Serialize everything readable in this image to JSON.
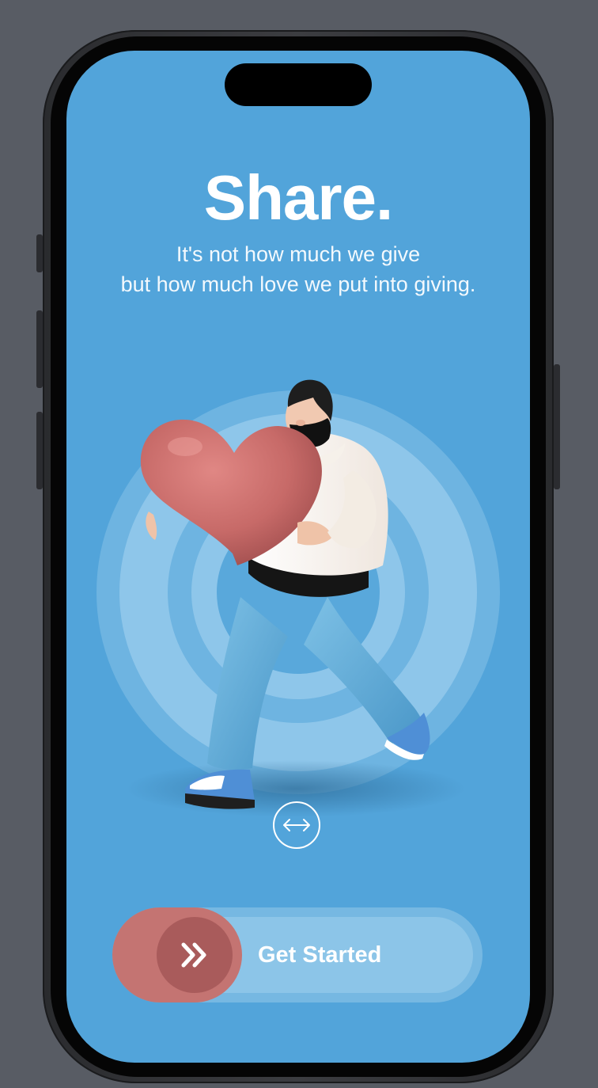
{
  "screen": {
    "title": "Share.",
    "subtitle_lines": [
      "It's not how much we give",
      "but how much love we put into giving."
    ]
  },
  "hero": {
    "illustration": "man-carrying-heart-illustration",
    "rings": "concentric-rings"
  },
  "swipe_hint": {
    "icon": "left-right-arrow-icon"
  },
  "slider": {
    "label": "Get Started",
    "knob_icon": "double-chevron-right-icon"
  },
  "colors": {
    "background": "#52a4da",
    "accent": "#c47472",
    "accent_dark": "#a95b5b",
    "track": "#8cc5e8",
    "text": "#ffffff"
  }
}
